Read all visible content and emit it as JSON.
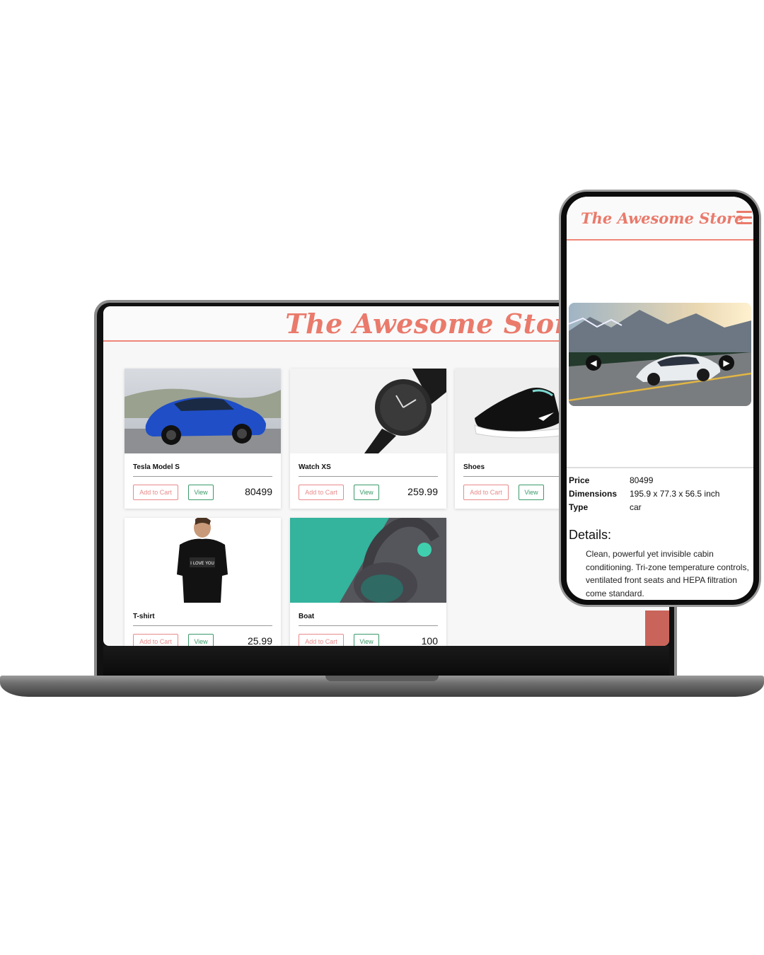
{
  "laptop": {
    "title": "The Awesome Store",
    "products": [
      {
        "name": "Tesla Model S",
        "price": "80499",
        "add_label": "Add to Cart",
        "view_label": "View"
      },
      {
        "name": "Watch XS",
        "price": "259.99",
        "add_label": "Add to Cart",
        "view_label": "View"
      },
      {
        "name": "Shoes",
        "price": "",
        "add_label": "Add to Cart",
        "view_label": "View"
      },
      {
        "name": "T-shirt",
        "price": "25.99",
        "add_label": "Add to Cart",
        "view_label": "View"
      },
      {
        "name": "Boat",
        "price": "100",
        "add_label": "Add to Cart",
        "view_label": "View"
      }
    ]
  },
  "phone": {
    "title": "The Awesome Store",
    "carousel_prev_icon": "arrow-left-icon",
    "carousel_next_icon": "arrow-right-icon",
    "specs": [
      {
        "key": "Price",
        "value": "80499"
      },
      {
        "key": "Dimensions",
        "value": "195.9 x 77.3 x 56.5 inch"
      },
      {
        "key": "Type",
        "value": "car"
      }
    ],
    "details_heading": "Details:",
    "details_text": "Clean, powerful yet invisible cabin conditioning. Tri-zone temperature controls, ventilated front seats and HEPA filtration come standard."
  },
  "colors": {
    "brand": "#ea7a6b",
    "view_button": "#3b9a6a",
    "cart_button": "#e88a8a"
  }
}
